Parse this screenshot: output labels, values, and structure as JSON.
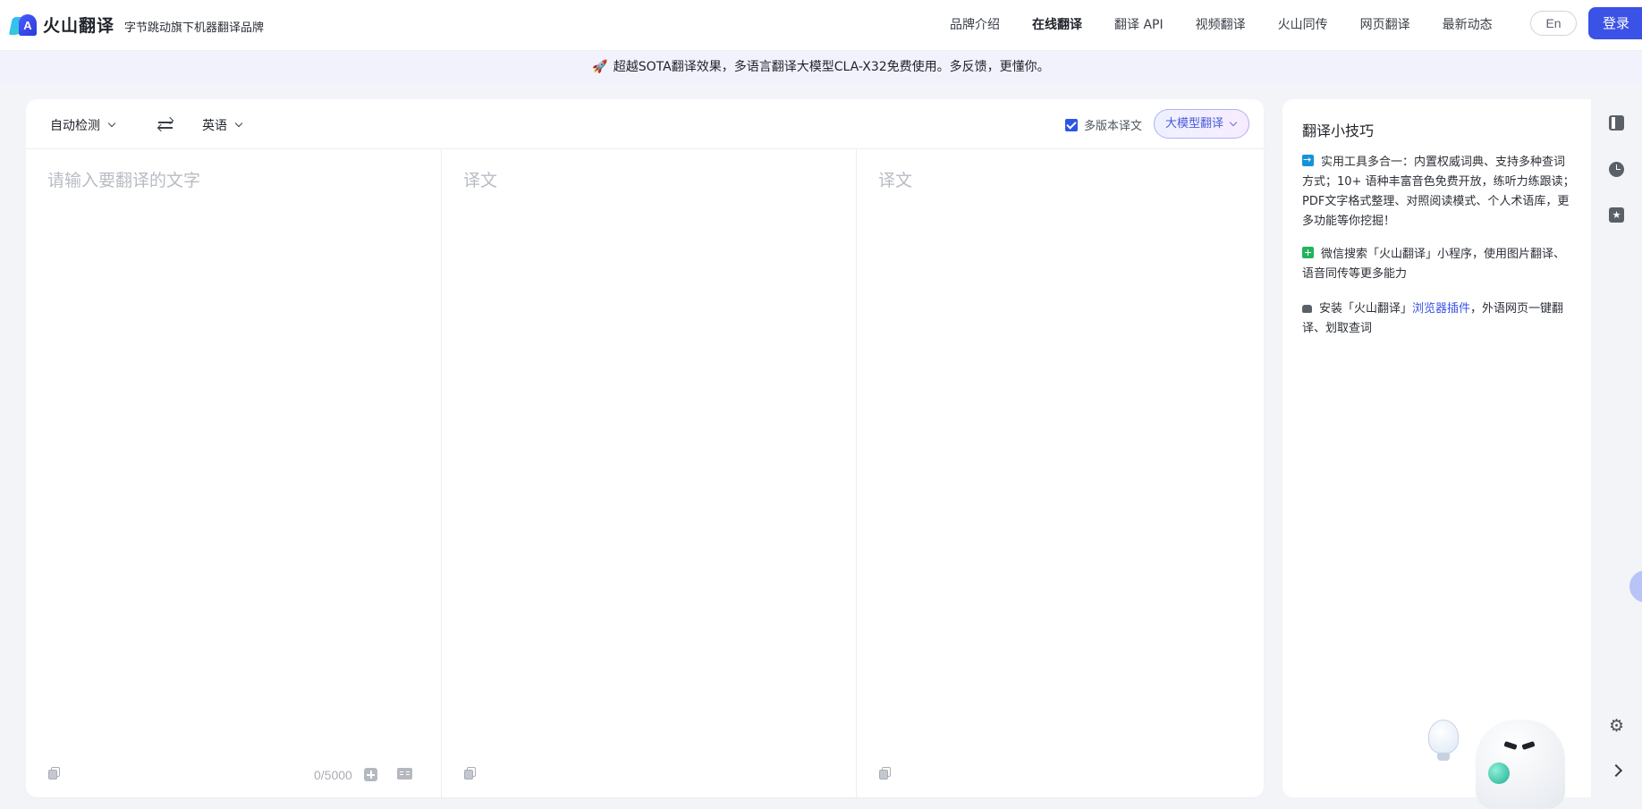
{
  "header": {
    "logo_text": "火山翻译",
    "logo_mark_letter": "A",
    "slogan": "字节跳动旗下机器翻译品牌",
    "nav": [
      {
        "label": "品牌介绍",
        "active": false
      },
      {
        "label": "在线翻译",
        "active": true
      },
      {
        "label": "翻译 API",
        "active": false
      },
      {
        "label": "视频翻译",
        "active": false
      },
      {
        "label": "火山同传",
        "active": false
      },
      {
        "label": "网页翻译",
        "active": false
      },
      {
        "label": "最新动态",
        "active": false
      }
    ],
    "lang_toggle": "En",
    "login": "登录"
  },
  "banner": {
    "icon": "rocket-icon",
    "text": "超越SOTA翻译效果，多语言翻译大模型CLA-X32免费使用。多反馈，更懂你。"
  },
  "translator": {
    "source_lang": "自动检测",
    "target_lang": "英语",
    "multi_version_label": "多版本译文",
    "multi_version_checked": true,
    "llm_button": "大模型翻译",
    "source_placeholder": "请输入要翻译的文字",
    "target_placeholder_1": "译文",
    "target_placeholder_2": "译文",
    "char_count": "0/5000"
  },
  "tips": {
    "title": "翻译小技巧",
    "items": [
      {
        "icon": "arrow-right-icon",
        "text": "实用工具多合一：内置权威词典、支持多种查词方式；10+ 语种丰富音色免费开放，练听力练跟读；PDF文字格式整理、对照阅读模式、个人术语库，更多功能等你挖掘！"
      },
      {
        "icon": "plus-square-icon",
        "text": "微信搜索「火山翻译」小程序，使用图片翻译、语音同传等更多能力"
      },
      {
        "icon": "extension-icon",
        "text_before": "安装「火山翻译」",
        "link": "浏览器插件",
        "text_after": "，外语网页一键翻译、划取查词"
      }
    ]
  },
  "colors": {
    "primary": "#3b52e6",
    "page_bg": "#f3f4f8",
    "banner_bg": "#f1f2fb",
    "placeholder": "#b8bcc4"
  }
}
